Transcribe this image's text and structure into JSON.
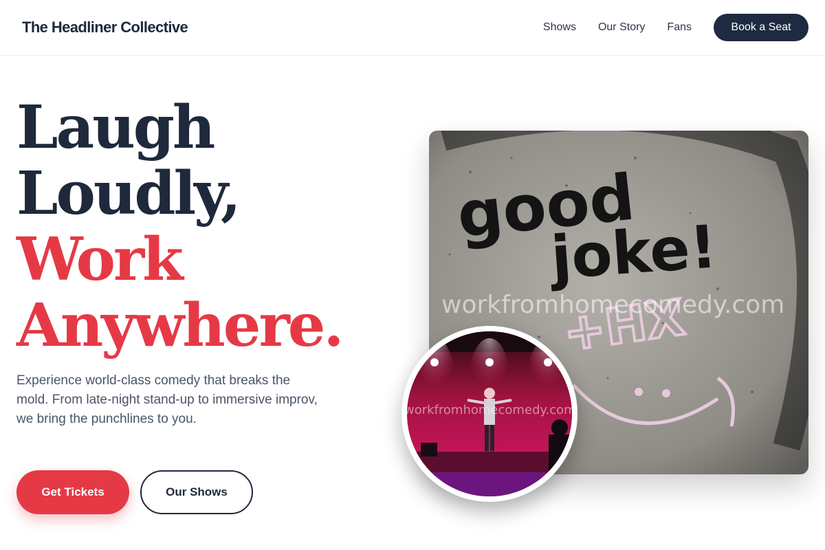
{
  "header": {
    "brand": "The Headliner Collective",
    "nav": [
      "Shows",
      "Our Story",
      "Fans"
    ],
    "cta": "Book a Seat"
  },
  "hero": {
    "title_lines": [
      "Laugh",
      "Loudly,",
      "Work",
      "Anywhere."
    ],
    "description": "Experience world-class comedy that breaks the mold. From late-night stand-up to immersive improv, we bring the punchlines to you.",
    "primary_button": "Get Tickets",
    "secondary_button": "Our Shows"
  },
  "images": {
    "main_photo": {
      "graffiti_line1": "good",
      "graffiti_line2": "joke!",
      "chalk_text": "+HX",
      "watermark": "workfromhomecomedy.com"
    },
    "stage_photo": {
      "watermark": "workfromhomecomedy.com"
    }
  },
  "colors": {
    "brand_dark": "#1e293b",
    "accent_red": "#e63946"
  }
}
